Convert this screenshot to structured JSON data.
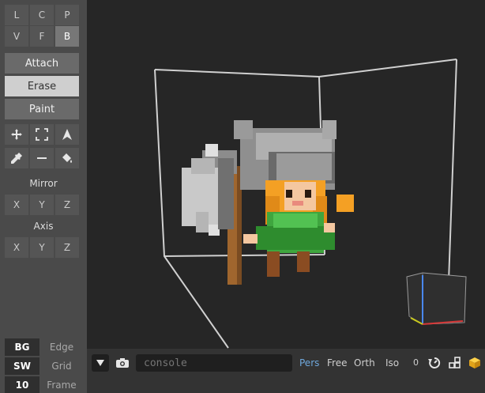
{
  "sidebar": {
    "brush_row1": [
      "L",
      "C",
      "P"
    ],
    "brush_row2": [
      "V",
      "F",
      "B"
    ],
    "modes": [
      "Attach",
      "Erase",
      "Paint"
    ],
    "tools": [
      "move-icon",
      "select-box-icon",
      "pointer-icon",
      "eyedropper-icon",
      "line-icon",
      "fill-bucket-icon"
    ],
    "mirror_label": "Mirror",
    "mirror_axes": [
      "X",
      "Y",
      "Z"
    ],
    "axis_label": "Axis",
    "axis_axes": [
      "X",
      "Y",
      "Z"
    ],
    "bottom": {
      "bg": "BG",
      "edge": "Edge",
      "sw": "SW",
      "grid": "Grid",
      "size": "10",
      "frame": "Frame"
    }
  },
  "bottombar": {
    "console_placeholder": "console",
    "projections": [
      "Pers",
      "Free",
      "Orth",
      "Iso"
    ],
    "counter": "0"
  },
  "colors": {
    "sidebar_bg": "#4a4a4a",
    "viewport_bg": "#262626",
    "active_projection": "#6fa8dc"
  }
}
